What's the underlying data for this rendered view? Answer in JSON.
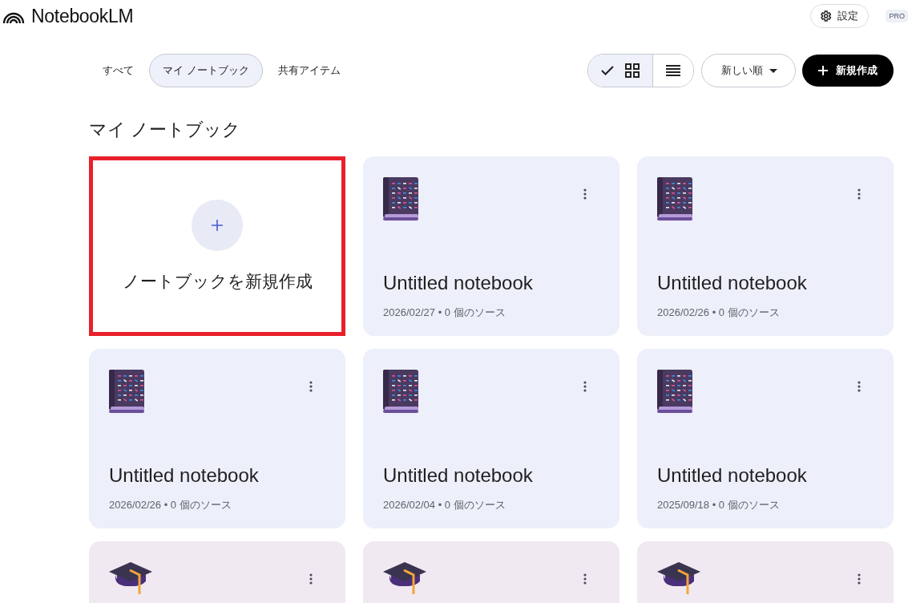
{
  "app": {
    "title": "NotebookLM",
    "settings_label": "設定",
    "plan_badge": "PRO"
  },
  "filter_tabs": [
    {
      "label": "すべて",
      "selected": false
    },
    {
      "label": "マイ ノートブック",
      "selected": true
    },
    {
      "label": "共有アイテム",
      "selected": false
    }
  ],
  "view_toggle": [
    {
      "kind": "grid",
      "selected": true
    },
    {
      "kind": "list",
      "selected": false
    }
  ],
  "sort": {
    "label": "新しい順"
  },
  "create_button": {
    "label": "新規作成"
  },
  "section_title": "マイ ノートブック",
  "new_notebook_card": {
    "label": "ノートブックを新規作成",
    "highlighted": true
  },
  "notebooks": [
    {
      "kind": "book",
      "title": "Untitled notebook",
      "meta": "2026/02/27 • 0 個のソース"
    },
    {
      "kind": "book",
      "title": "Untitled notebook",
      "meta": "2026/02/26 • 0 個のソース"
    },
    {
      "kind": "book",
      "title": "Untitled notebook",
      "meta": "2026/02/26 • 0 個のソース"
    },
    {
      "kind": "book",
      "title": "Untitled notebook",
      "meta": "2026/02/04 • 0 個のソース"
    },
    {
      "kind": "book",
      "title": "Untitled notebook",
      "meta": "2025/09/18 • 0 個のソース"
    },
    {
      "kind": "course"
    },
    {
      "kind": "course"
    },
    {
      "kind": "course"
    }
  ]
}
